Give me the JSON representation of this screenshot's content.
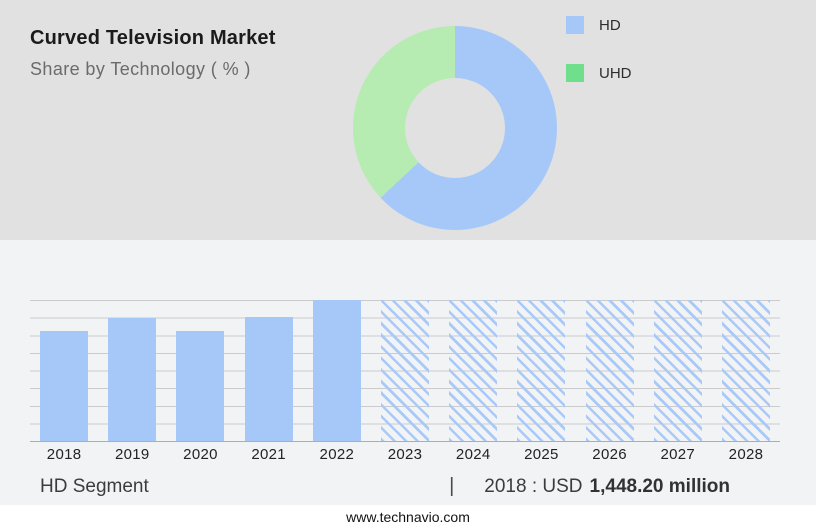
{
  "header": {
    "title": "Curved Television Market",
    "subtitle": "Share by Technology ( % )"
  },
  "legend": {
    "items": [
      {
        "label": "HD",
        "color": "#a6c8f9"
      },
      {
        "label": "UHD",
        "color": "#70df8c"
      }
    ]
  },
  "chart_data": [
    {
      "type": "pie",
      "title": "Curved Television Market - Share by Technology ( % )",
      "labels": [
        "HD",
        "UHD"
      ],
      "values": [
        63,
        37
      ],
      "colors": [
        "#a6c8f9",
        "#b6ecb2"
      ],
      "donut_hole_ratio": 0.49,
      "start_angle_deg": 0,
      "legend_position": "top-right"
    },
    {
      "type": "bar",
      "categories": [
        "2018",
        "2019",
        "2020",
        "2021",
        "2022",
        "2023",
        "2024",
        "2025",
        "2026",
        "2027",
        "2028"
      ],
      "values": [
        78,
        87,
        78,
        88,
        100,
        100,
        100,
        100,
        100,
        100,
        100
      ],
      "value_unit": "relative bar height, % of tallest bar (no y-axis shown)",
      "bar_styles": [
        "solid",
        "solid",
        "solid",
        "solid",
        "solid",
        "hatched",
        "hatched",
        "hatched",
        "hatched",
        "hatched",
        "hatched"
      ],
      "bar_color": "#a6c8f9",
      "hatch_style": "diagonal-backslash",
      "gridlines": 9,
      "grid_on": true,
      "xlabel": "",
      "ylabel": "",
      "known_point": {
        "year": "2018",
        "value_label": "USD 1,448.20 million"
      }
    }
  ],
  "summary": {
    "segment_label": "HD Segment",
    "separator": "|",
    "value_prefix": "2018 : USD",
    "value_bold": "1,448.20 million"
  },
  "footer": {
    "website": "www.technavio.com"
  }
}
